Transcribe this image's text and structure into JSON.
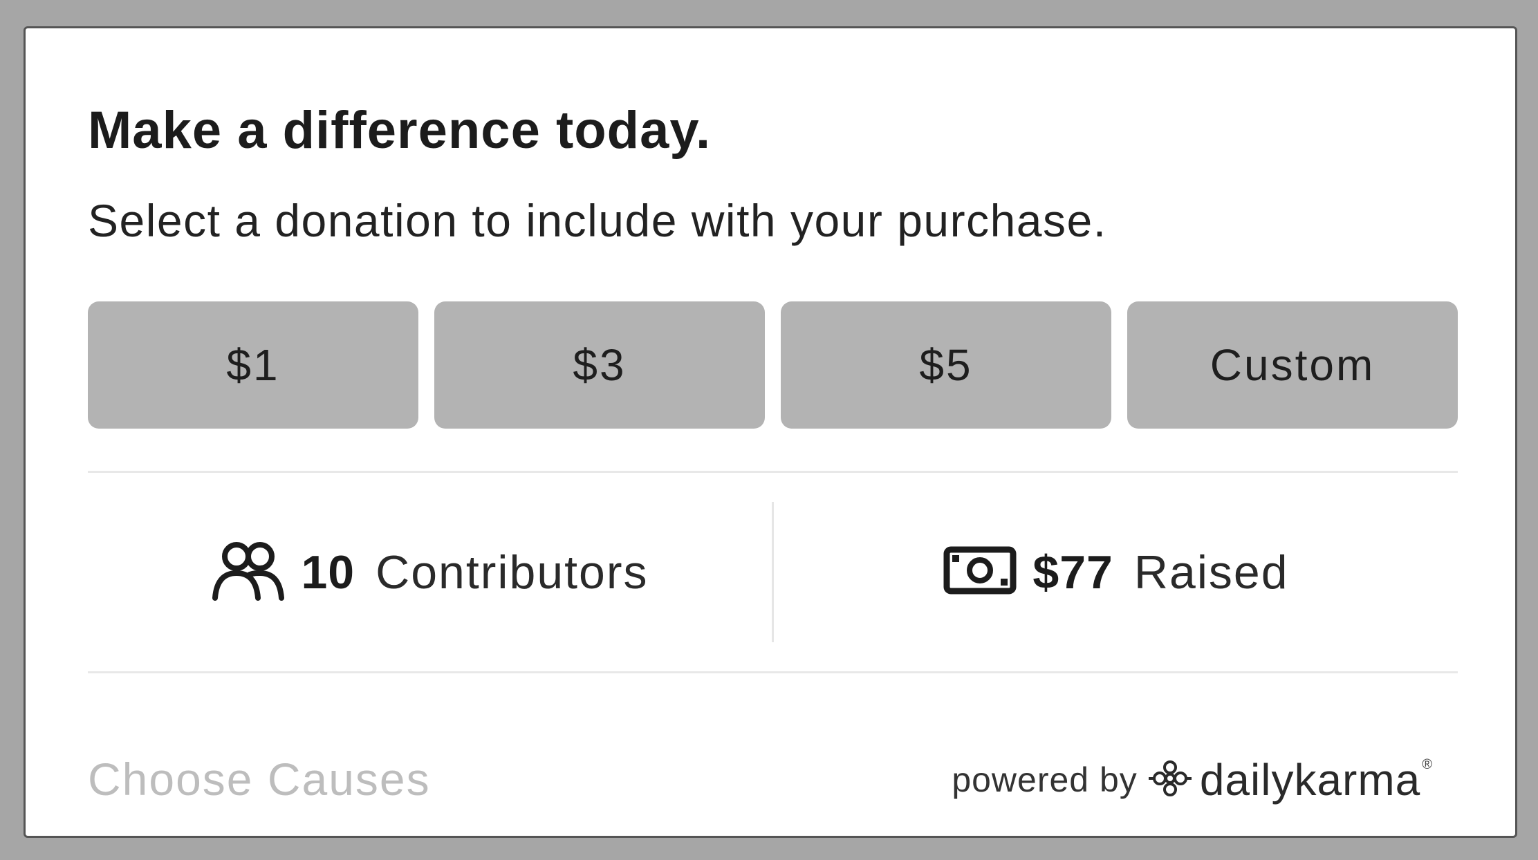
{
  "widget": {
    "headline": "Make a difference today.",
    "subline": "Select a donation to include with your purchase.",
    "amounts": [
      "$1",
      "$3",
      "$5",
      "Custom"
    ],
    "stats": {
      "contributors": {
        "value": "10",
        "label": "Contributors",
        "icon": "people-icon"
      },
      "raised": {
        "value": "$77",
        "label": "Raised",
        "icon": "money-icon"
      }
    },
    "choose_causes": "Choose Causes",
    "powered_by": "powered by",
    "brand": "dailykarma",
    "brand_mark": "®"
  },
  "colors": {
    "background": "#a6a6a6",
    "card": "#ffffff",
    "button": "#b3b3b3",
    "muted_link": "#bdbdbd",
    "text": "#1c1c1c"
  }
}
